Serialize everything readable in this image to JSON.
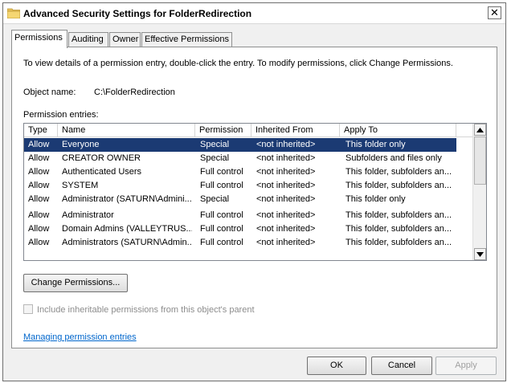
{
  "window": {
    "title": "Advanced Security Settings for FolderRedirection",
    "close_glyph": "✕"
  },
  "tabs": [
    {
      "label": "Permissions",
      "active": true
    },
    {
      "label": "Auditing",
      "active": false
    },
    {
      "label": "Owner",
      "active": false
    },
    {
      "label": "Effective Permissions",
      "active": false
    }
  ],
  "permissions_tab": {
    "info_text": "To view details of a permission entry, double-click the entry. To modify permissions, click Change Permissions.",
    "object_name_label": "Object name:",
    "object_name_value": "C:\\FolderRedirection",
    "entries_label": "Permission entries:",
    "columns": [
      "Type",
      "Name",
      "Permission",
      "Inherited From",
      "Apply To"
    ],
    "rows": [
      {
        "type": "Allow",
        "name": "Everyone",
        "permission": "Special",
        "inherited_from": "<not inherited>",
        "apply_to": "This folder only",
        "selected": true
      },
      {
        "type": "Allow",
        "name": "CREATOR OWNER",
        "permission": "Special",
        "inherited_from": "<not inherited>",
        "apply_to": "Subfolders and files only",
        "selected": false
      },
      {
        "type": "Allow",
        "name": "Authenticated Users",
        "permission": "Full control",
        "inherited_from": "<not inherited>",
        "apply_to": "This folder, subfolders an...",
        "selected": false
      },
      {
        "type": "Allow",
        "name": "SYSTEM",
        "permission": "Full control",
        "inherited_from": "<not inherited>",
        "apply_to": "This folder, subfolders an...",
        "selected": false
      },
      {
        "type": "Allow",
        "name": "Administrator (SATURN\\Admini...",
        "permission": "Special",
        "inherited_from": "<not inherited>",
        "apply_to": "This folder only",
        "selected": false
      },
      {
        "type": "Allow",
        "name": "Administrator",
        "permission": "Full control",
        "inherited_from": "<not inherited>",
        "apply_to": "This folder, subfolders an...",
        "selected": false
      },
      {
        "type": "Allow",
        "name": "Domain Admins (VALLEYTRUS...",
        "permission": "Full control",
        "inherited_from": "<not inherited>",
        "apply_to": "This folder, subfolders an...",
        "selected": false
      },
      {
        "type": "Allow",
        "name": "Administrators (SATURN\\Admin...",
        "permission": "Full control",
        "inherited_from": "<not inherited>",
        "apply_to": "This folder, subfolders an...",
        "selected": false
      }
    ],
    "change_permissions_label": "Change Permissions...",
    "include_inheritable_label": "Include inheritable permissions from this object's parent",
    "include_inheritable_checked": false,
    "managing_link": "Managing permission entries"
  },
  "buttons": {
    "ok": "OK",
    "cancel": "Cancel",
    "apply": "Apply"
  },
  "icons": {
    "window_icon": "folder-icon",
    "close": "close-icon",
    "scroll_up": "scroll-up-arrow-icon",
    "scroll_down": "scroll-down-arrow-icon"
  },
  "colors": {
    "selection": "#1b3a73",
    "link": "#0066cc",
    "dialog_bg": "#f0f0f0"
  }
}
